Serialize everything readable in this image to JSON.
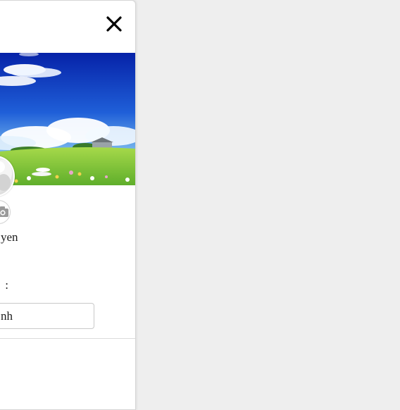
{
  "dialog": {
    "close_icon": "close-icon",
    "cover_image": "landscape-cover-photo",
    "avatar_image": "profile-avatar",
    "camera_icon": "camera-icon",
    "name_text": "yen",
    "field_label": ":",
    "field_value": "nh"
  },
  "colors": {
    "page_background": "#eeeeee",
    "panel_background": "#ffffff",
    "sky_top": "#0a2bb8",
    "sky_bottom": "#6fb6ef",
    "grass": "#7cc23a",
    "text": "#1b1b1b"
  }
}
